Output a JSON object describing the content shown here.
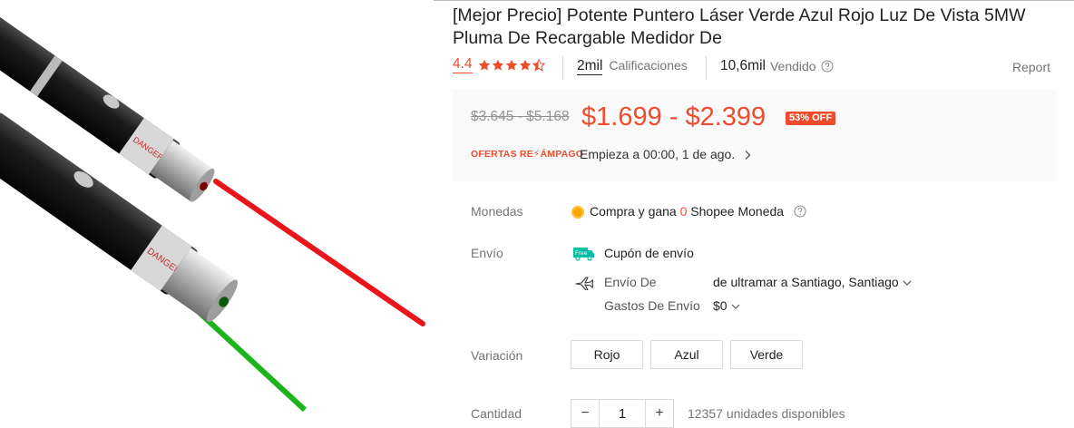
{
  "product": {
    "title": "[Mejor Precio] Potente Puntero Láser Verde Azul Rojo Luz De Vista 5MW Pluma De Recargable Medidor De",
    "rating": "4.4",
    "rating_stars": 4.4,
    "ratings_count": "2mil",
    "ratings_label": "Calificaciones",
    "sold_count": "10,6mil",
    "sold_label": "Vendido",
    "report_label": "Report"
  },
  "price": {
    "original_range": "$3.645 - $5.168",
    "current_range": "$1.699 - $2.399",
    "discount_badge": "53% OFF"
  },
  "flash_sale": {
    "logo_text": "OFERTAS RE⚡ÁMPAGO",
    "text": "Empieza a 00:00, 1 de ago."
  },
  "coins": {
    "label": "Monedas",
    "text_before": "Compra y gana ",
    "amount": "0",
    "text_after": " Shopee Moneda"
  },
  "shipping": {
    "label": "Envío",
    "free_badge": "Free",
    "coupon_text": "Cupón de envío",
    "from_label": "Envío De",
    "from_value": "de ultramar a Santiago, Santiago",
    "cost_label": "Gastos De Envío",
    "cost_value": "$0"
  },
  "variation": {
    "label": "Variación",
    "options": [
      "Rojo",
      "Azul",
      "Verde"
    ]
  },
  "quantity": {
    "label": "Cantidad",
    "minus": "−",
    "value": "1",
    "plus": "+",
    "stock_text": "12357 unidades disponibles"
  },
  "colors": {
    "accent": "#ee4d2d",
    "price_bg": "#fafafa",
    "laser_red": "#e8161a",
    "laser_green": "#1db31d"
  }
}
